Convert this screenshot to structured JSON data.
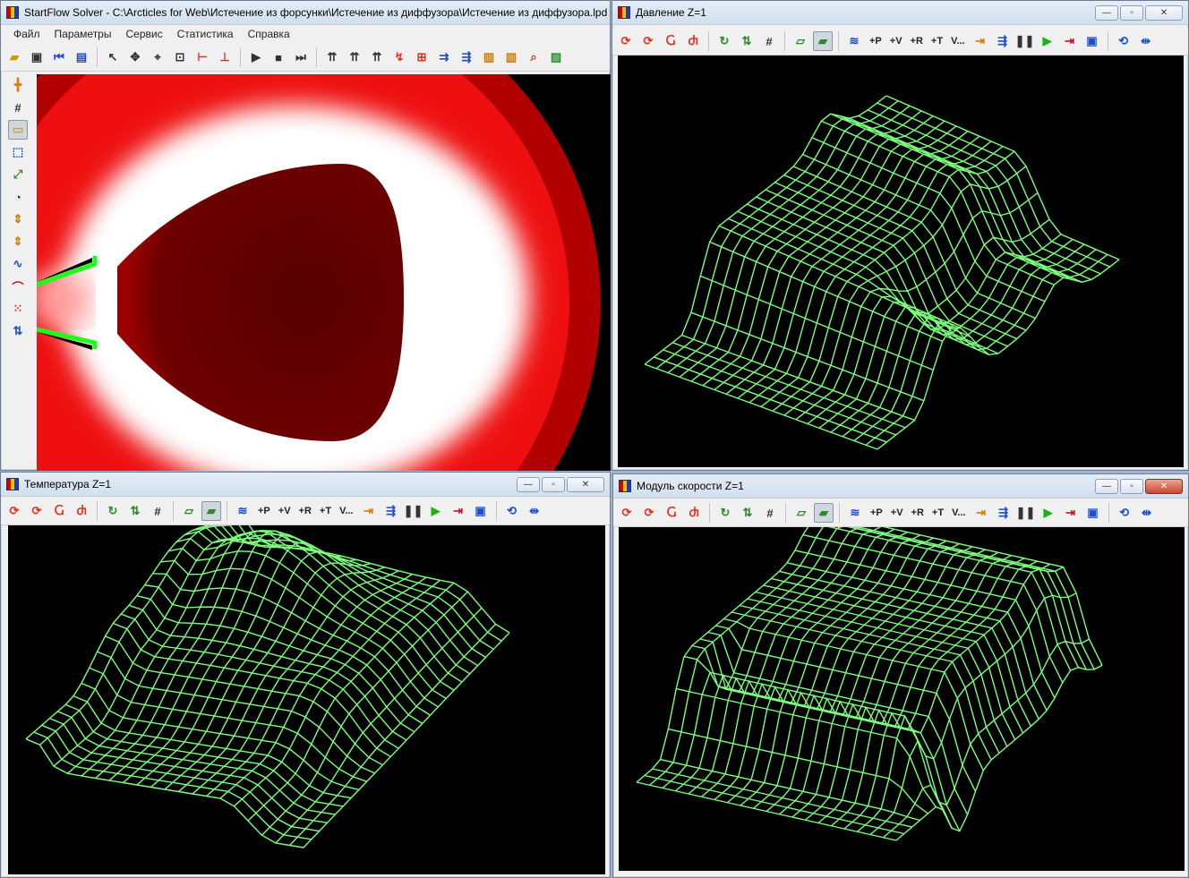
{
  "main": {
    "title": "StartFlow Solver - C:\\Arcticles for Web\\Истечение из форсунки\\Истечение из диффузора\\Истечение из диффузора.lpd",
    "menu": [
      "Файл",
      "Параметры",
      "Сервис",
      "Статистика",
      "Справка"
    ]
  },
  "plots": [
    {
      "title": "Давление Z=1"
    },
    {
      "title": "Температура Z=1"
    },
    {
      "title": "Модуль скорости Z=1"
    }
  ],
  "toolbar_labels": {
    "p": "+P",
    "v": "+V",
    "r": "+R",
    "t": "+T",
    "vdots": "V..."
  },
  "window_buttons": {
    "minimize": "—",
    "restore": "▫",
    "close": "✕"
  },
  "colors": {
    "wire": "#7dff7d",
    "field_dark": "#5c0000",
    "field_red": "#e00000",
    "nozzle": "#1bff1b"
  },
  "icons": {
    "main_toolbar": [
      "open-icon",
      "save-icon",
      "first-frame-icon",
      "save-as-icon",
      "pointer-icon",
      "pan-icon",
      "zoom-fit-icon",
      "zoom-icon",
      "dimension-h-icon",
      "dimension-v-icon",
      "play-icon",
      "stop-icon",
      "step-icon",
      "vectors-icon",
      "vectors-dense-icon",
      "vectors-alt-icon",
      "streamline-icon",
      "grid-cells-icon",
      "flow-arrows-icon",
      "flow-arrows-alt-icon",
      "palette-icon",
      "palette-alt-icon",
      "probe-icon",
      "image-icon"
    ],
    "side_toolbar": [
      "crosshair-icon",
      "grid-icon",
      "gradient-icon",
      "select-area-icon",
      "line-probe-icon",
      "shapes-icon",
      "scale-icon",
      "scale-alt-icon",
      "wave-icon",
      "curve-icon",
      "dotted-area-icon",
      "flip-icon"
    ]
  }
}
